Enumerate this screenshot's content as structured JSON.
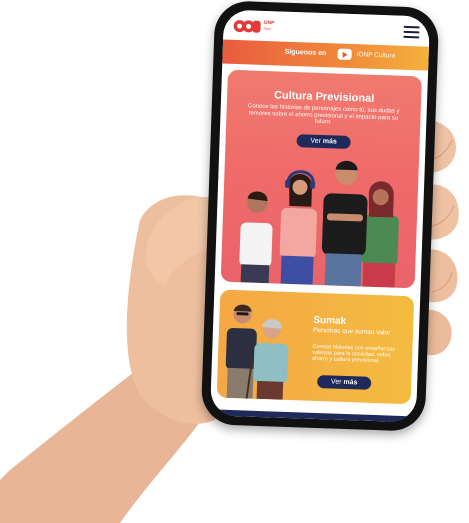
{
  "header": {
    "logo_text": "ONP",
    "logo_subtext": "Perú"
  },
  "social_bar": {
    "label": "Síguenos en",
    "icon": "youtube-icon",
    "channel": "/ONP Cultura"
  },
  "card_cultura": {
    "title": "Cultura Previsional",
    "description": "Conoce las historias de personajes como tú, sus dudas y temores sobre el ahorro previsional y el impacto para su futuro.",
    "button_prefix": "Ver ",
    "button_bold": "más"
  },
  "card_sumak": {
    "title": "Sumak",
    "subtitle": "Personas que suman valor",
    "description": "Conoce historias con enseñanzas valiosas para la sociedad, sobre ahorro y cultura previsional.",
    "button_prefix": "Ver ",
    "button_bold": "más"
  },
  "colors": {
    "accent_red": "#ef6a6a",
    "accent_orange": "#f08a3a",
    "accent_yellow": "#f3bb3f",
    "button_navy": "#1e2a5a"
  }
}
